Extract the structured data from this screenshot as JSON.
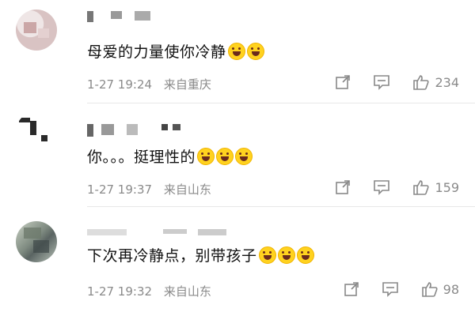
{
  "comments": [
    {
      "text": "母爱的力量使你冷静",
      "time": "1-27 19:24",
      "location": "来自重庆",
      "likes": "234"
    },
    {
      "text": "你。。。挺理性的",
      "time": "1-27 19:37",
      "location": "来自山东",
      "likes": "159"
    },
    {
      "text": "下次再冷静点，别带孩子",
      "time": "1-27 19:32",
      "location": "来自山东",
      "likes": "98"
    }
  ],
  "icons": {
    "share": "share-icon",
    "comment": "comment-icon",
    "like": "thumbs-up-icon",
    "emoji": "laughing-face-emoji"
  },
  "colors": {
    "text": "#111111",
    "meta": "#8a8a8a",
    "divider": "#e8e8e8",
    "emoji_yellow": "#ffd21f"
  }
}
